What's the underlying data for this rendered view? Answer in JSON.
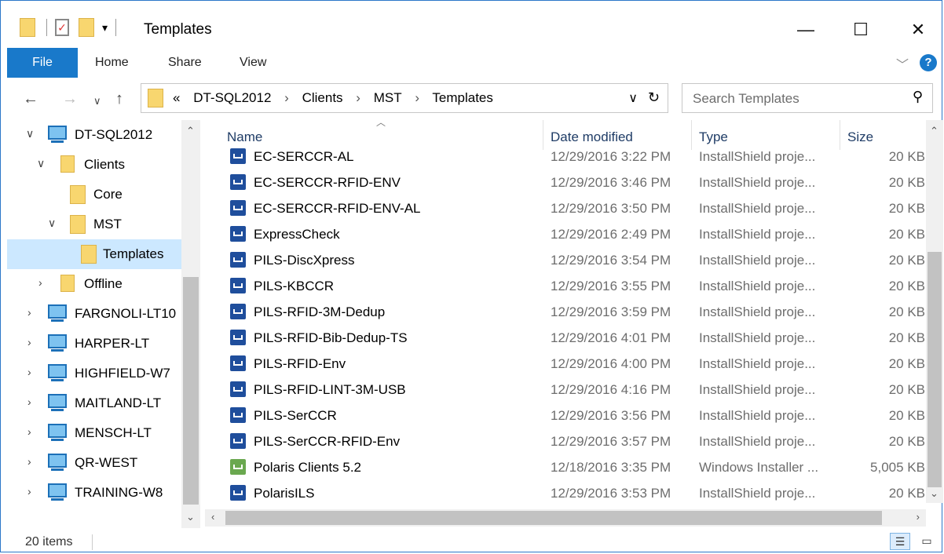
{
  "window": {
    "title": "Templates",
    "controls": {
      "minimize": "—",
      "maximize": "☐",
      "close": "✕"
    }
  },
  "ribbon": {
    "tabs": [
      "File",
      "Home",
      "Share",
      "View"
    ],
    "help": "?"
  },
  "address": {
    "prefix": "«",
    "breadcrumb": [
      "DT-SQL2012",
      "Clients",
      "MST",
      "Templates"
    ],
    "separator": "›"
  },
  "search": {
    "placeholder": "Search Templates"
  },
  "tree": [
    {
      "label": "DT-SQL2012",
      "icon": "computer-icon",
      "indent": 0,
      "expander": "expanded"
    },
    {
      "label": "Clients",
      "icon": "folder-user-icon",
      "indent": 1,
      "expander": "expanded"
    },
    {
      "label": "Core",
      "icon": "folder-icon",
      "indent": 2,
      "expander": "none"
    },
    {
      "label": "MST",
      "icon": "folder-icon",
      "indent": 1,
      "expander": "expanded"
    },
    {
      "label": "Templates",
      "icon": "folder-icon",
      "indent": 2,
      "expander": "none",
      "selected": true
    },
    {
      "label": "Offline",
      "icon": "folder-user-icon",
      "indent": 1,
      "expander": "collapsed"
    },
    {
      "label": "FARGNOLI-LT10",
      "icon": "computer-icon",
      "indent": 0,
      "expander": "collapsed"
    },
    {
      "label": "HARPER-LT",
      "icon": "computer-icon",
      "indent": 0,
      "expander": "collapsed"
    },
    {
      "label": "HIGHFIELD-W7",
      "icon": "computer-icon",
      "indent": 0,
      "expander": "collapsed"
    },
    {
      "label": "MAITLAND-LT",
      "icon": "computer-icon",
      "indent": 0,
      "expander": "collapsed"
    },
    {
      "label": "MENSCH-LT",
      "icon": "computer-icon",
      "indent": 0,
      "expander": "collapsed"
    },
    {
      "label": "QR-WEST",
      "icon": "computer-icon",
      "indent": 0,
      "expander": "collapsed"
    },
    {
      "label": "TRAINING-W8",
      "icon": "computer-icon",
      "indent": 0,
      "expander": "collapsed"
    }
  ],
  "columns": [
    "Name",
    "Date modified",
    "Type",
    "Size"
  ],
  "files": [
    {
      "name": "EC-SERCCR-AL",
      "date": "12/29/2016 3:22 PM",
      "type": "InstallShield proje...",
      "size": "20 KB",
      "icon": "installshield-project-icon"
    },
    {
      "name": "EC-SERCCR-RFID-ENV",
      "date": "12/29/2016 3:46 PM",
      "type": "InstallShield proje...",
      "size": "20 KB",
      "icon": "installshield-project-icon"
    },
    {
      "name": "EC-SERCCR-RFID-ENV-AL",
      "date": "12/29/2016 3:50 PM",
      "type": "InstallShield proje...",
      "size": "20 KB",
      "icon": "installshield-project-icon"
    },
    {
      "name": "ExpressCheck",
      "date": "12/29/2016 2:49 PM",
      "type": "InstallShield proje...",
      "size": "20 KB",
      "icon": "installshield-project-icon"
    },
    {
      "name": "PILS-DiscXpress",
      "date": "12/29/2016 3:54 PM",
      "type": "InstallShield proje...",
      "size": "20 KB",
      "icon": "installshield-project-icon"
    },
    {
      "name": "PILS-KBCCR",
      "date": "12/29/2016 3:55 PM",
      "type": "InstallShield proje...",
      "size": "20 KB",
      "icon": "installshield-project-icon"
    },
    {
      "name": "PILS-RFID-3M-Dedup",
      "date": "12/29/2016 3:59 PM",
      "type": "InstallShield proje...",
      "size": "20 KB",
      "icon": "installshield-project-icon"
    },
    {
      "name": "PILS-RFID-Bib-Dedup-TS",
      "date": "12/29/2016 4:01 PM",
      "type": "InstallShield proje...",
      "size": "20 KB",
      "icon": "installshield-project-icon"
    },
    {
      "name": "PILS-RFID-Env",
      "date": "12/29/2016 4:00 PM",
      "type": "InstallShield proje...",
      "size": "20 KB",
      "icon": "installshield-project-icon"
    },
    {
      "name": "PILS-RFID-LINT-3M-USB",
      "date": "12/29/2016 4:16 PM",
      "type": "InstallShield proje...",
      "size": "20 KB",
      "icon": "installshield-project-icon"
    },
    {
      "name": "PILS-SerCCR",
      "date": "12/29/2016 3:56 PM",
      "type": "InstallShield proje...",
      "size": "20 KB",
      "icon": "installshield-project-icon"
    },
    {
      "name": "PILS-SerCCR-RFID-Env",
      "date": "12/29/2016 3:57 PM",
      "type": "InstallShield proje...",
      "size": "20 KB",
      "icon": "installshield-project-icon"
    },
    {
      "name": "Polaris Clients 5.2",
      "date": "12/18/2016 3:35 PM",
      "type": "Windows Installer ...",
      "size": "5,005 KB",
      "icon": "windows-installer-icon"
    },
    {
      "name": "PolarisILS",
      "date": "12/29/2016 3:53 PM",
      "type": "InstallShield proje...",
      "size": "20 KB",
      "icon": "installshield-project-icon"
    }
  ],
  "status": {
    "items": "20 items"
  },
  "colors": {
    "accent": "#1979ca",
    "selection": "#cce8ff",
    "folder": "#f8d66f"
  }
}
